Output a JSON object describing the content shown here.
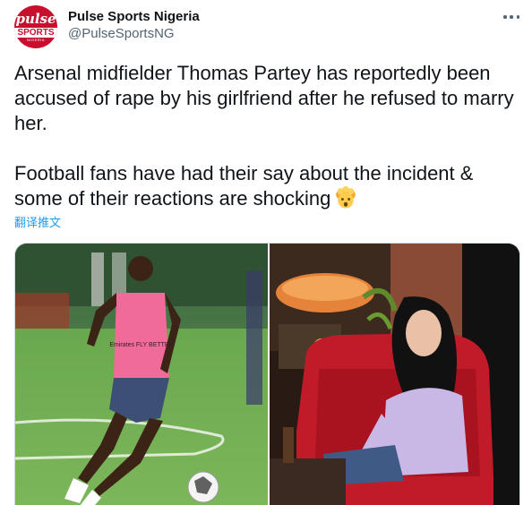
{
  "account": {
    "display_name": "Pulse Sports Nigeria",
    "handle": "@PulseSportsNG",
    "logo": {
      "line1": "pulse",
      "line2": "SPORTS",
      "line3": "NIGERIA"
    }
  },
  "tweet": {
    "paragraph1": "Arsenal midfielder Thomas Partey has reportedly been accused of rape by his girlfriend after he refused to marry her.",
    "paragraph2": "Football fans have had their say about the incident & some of their reactions are shocking",
    "emoji": "exploding-head-emoji",
    "translate_label": "翻译推文"
  },
  "media": {
    "photo1": {
      "jersey_text": "Emirates FLY BETTER"
    },
    "photo2": {}
  },
  "colors": {
    "brand_red": "#c8102e",
    "link_blue": "#1d9bf0",
    "text": "#0f1419",
    "secondary": "#536471"
  },
  "icons": {
    "more": "more-options-icon"
  }
}
